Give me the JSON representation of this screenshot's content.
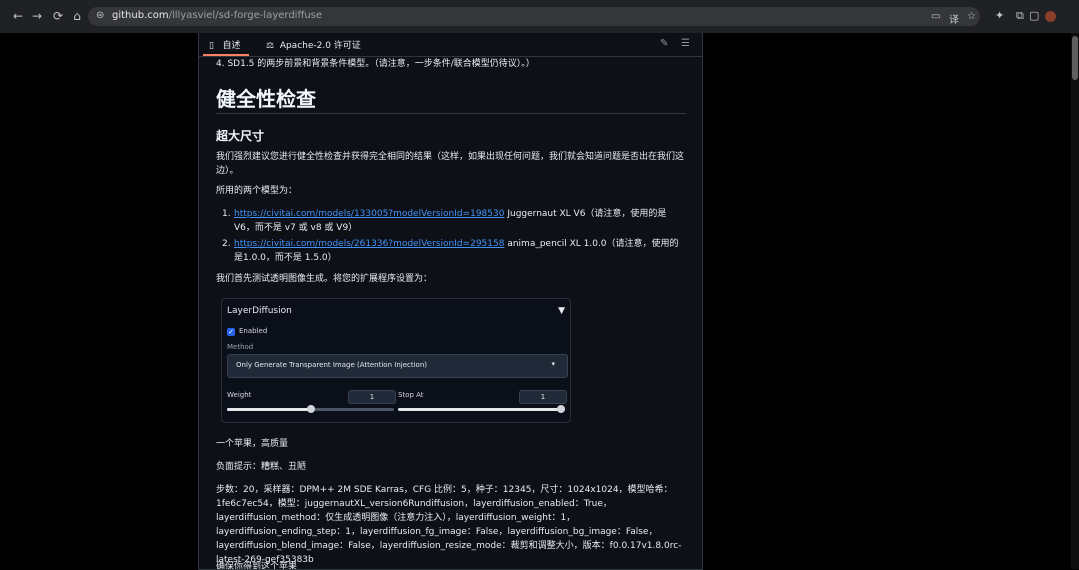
{
  "browser": {
    "nav_back": "←",
    "nav_forward": "→",
    "nav_reload": "⟳",
    "nav_home": "⌂",
    "url_host": "github.com",
    "url_path": "/lllyasviel/sd-forge-layerdiffuse",
    "tune_icon": "⊜",
    "right_icons": [
      "▭",
      "译",
      "☆",
      "✦",
      "⧉",
      "▢"
    ]
  },
  "panel": {
    "tab_readme": "自述",
    "tab_license": "Apache-2.0 许可证",
    "readme_icon": "▯",
    "license_icon": "⚖",
    "edit_icon": "✎",
    "toc_icon": "☰"
  },
  "doc": {
    "top_item": "4. SD1.5 的两步前景和背景条件模型。（请注意，一步条件/联合模型仍待议）。）",
    "h1": "健全性检查",
    "h3": "超大尺寸",
    "para1": "我们强烈建议您进行健全性检查并获得完全相同的结果（这样，如果出现任何问题，我们就会知道问题是否出在我们这边）。",
    "para2": "所用的两个模型为：",
    "list": [
      {
        "num": "1.",
        "link": "https://civitai.com/models/133005?modelVersionId=198530",
        "text": " Juggernaut XL V6（请注意，使用的是V6，而不是 v7 或 v8 或 V9）"
      },
      {
        "num": "2.",
        "link": "https://civitai.com/models/261336?modelVersionId=295158",
        "text": " anima_pencil XL 1.0.0（请注意，使用的是1.0.0，而不是 1.5.0）"
      }
    ],
    "para3": "我们首先测试透明图像生成。将您的扩展程序设置为：",
    "para4": "一个苹果，高质量",
    "para5": "负面提示：糟糕、丑陋",
    "para6": "步数：20，采样器：DPM++ 2M SDE Karras，CFG 比例：5，种子：12345，尺寸：1024x1024，模型哈希：1fe6c7ec54，模型：juggernautXL_version6Rundiffusion，layerdiffusion_enabled：True，layerdiffusion_method：仅生成透明图像（注意力注入），layerdiffusion_weight：1，layerdiffusion_ending_step：1，layerdiffusion_fg_image：False，layerdiffusion_bg_image：False，layerdiffusion_blend_image：False，layerdiffusion_resize_mode：裁剪和调整大小，版本：f0.0.17v1.8.0rc-latest-269-gef35383b",
    "para7": "确保你得到这个苹果"
  },
  "widget": {
    "title": "LayerDiffusion",
    "collapse_icon": "▼",
    "checkbox_checked": true,
    "checkbox_mark": "✓",
    "checkbox_label": "Enabled",
    "method_label": "Method",
    "method_value": "Only Generate Transparent Image (Attention Injection)",
    "select_caret": "▾",
    "weight_label": "Weight",
    "weight_value": "1",
    "weight_fraction": 0.5,
    "stop_label": "Stop At",
    "stop_value": "1",
    "stop_fraction": 1.0,
    "accent": "#2563eb"
  }
}
